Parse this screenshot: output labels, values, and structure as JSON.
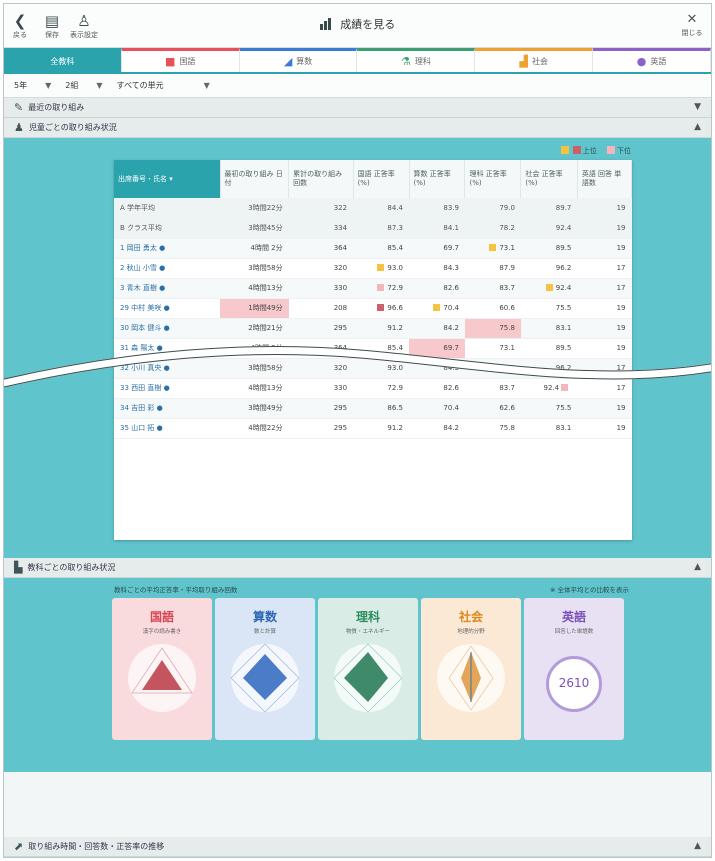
{
  "topbar": {
    "back_label": "戻る",
    "save_label": "保存",
    "print_label": "表示設定",
    "title": "成績を見る",
    "close_label": "閉じる"
  },
  "tabs": [
    {
      "label": "全教科",
      "key": "all"
    },
    {
      "label": "国語",
      "key": "kokugo"
    },
    {
      "label": "算数",
      "key": "sansu"
    },
    {
      "label": "理科",
      "key": "rika"
    },
    {
      "label": "社会",
      "key": "shakai"
    },
    {
      "label": "英語",
      "key": "eigo"
    }
  ],
  "filters": {
    "grade": "5年",
    "class": "2組",
    "scope": "すべての単元"
  },
  "sections": {
    "overall": "最近の取り組み",
    "per_student": "児童ごとの取り組み状況",
    "per_subject": "教科ごとの取り組み状況",
    "footer": "取り組み時間・回答数・正答率の推移"
  },
  "legend": {
    "high": "上位",
    "low": "下位"
  },
  "table": {
    "headers": [
      "出席番号・氏名",
      "最初の取り組み 日付",
      "累計の取り組み 回数",
      "国語 正答率 (%)",
      "算数 正答率 (%)",
      "理科 正答率 (%)",
      "社会 正答率 (%)",
      "英語 回答 単語数"
    ],
    "rows": [
      [
        "A 学年平均",
        "3時間22分",
        "322",
        "84.4",
        "83.9",
        "79.0",
        "89.7",
        "19"
      ],
      [
        "B クラス平均",
        "3時間45分",
        "334",
        "87.3",
        "84.1",
        "78.2",
        "92.4",
        "19"
      ],
      [
        "1 岡田 勇太 ●",
        "4時間 2分",
        "364",
        "85.4",
        "69.7",
        "73.1",
        "89.5",
        "19"
      ],
      [
        "2 秋山 小雪 ●",
        "3時間58分",
        "320",
        "93.0",
        "84.3",
        "87.9",
        "96.2",
        "17"
      ],
      [
        "3 青木 直樹 ●",
        "4時間13分",
        "330",
        "72.9",
        "82.6",
        "83.7",
        "92.4",
        "17"
      ],
      [
        "29 中村 美咲 ●",
        "1時間49分",
        "208",
        "96.6",
        "70.4",
        "60.6",
        "75.5",
        "19"
      ],
      [
        "30 岡本 健斗 ●",
        "2時間21分",
        "295",
        "91.2",
        "84.2",
        "75.8",
        "83.1",
        "19"
      ],
      [
        "31 森 陽太 ●",
        "4時間 2分",
        "364",
        "85.4",
        "69.7",
        "73.1",
        "89.5",
        "19"
      ],
      [
        "32 小川 真央 ●",
        "3時間58分",
        "320",
        "93.0",
        "84.3",
        "87.9",
        "96.2",
        "17"
      ],
      [
        "33 西田 直樹 ●",
        "4時間13分",
        "330",
        "72.9",
        "82.6",
        "83.7",
        "92.4",
        "17"
      ],
      [
        "34 吉田 彩 ●",
        "3時間49分",
        "295",
        "86.5",
        "70.4",
        "62.6",
        "75.5",
        "19"
      ],
      [
        "35 山口 拓 ●",
        "4時間22分",
        "295",
        "91.2",
        "84.2",
        "75.8",
        "83.1",
        "19"
      ]
    ]
  },
  "subjects_panel": {
    "title": "教科ごとの平均正答率・平均取り組み回数",
    "note": "※ 全体平均との比較を表示",
    "cards": [
      {
        "name": "国語",
        "sub": "漢字の読み書き"
      },
      {
        "name": "算数",
        "sub": "数と計算"
      },
      {
        "name": "理科",
        "sub": "物質・エネルギー"
      },
      {
        "name": "社会",
        "sub": "地理的分野"
      },
      {
        "name": "英語",
        "sub": "回答した単語数",
        "count": "2610"
      }
    ]
  },
  "colors": {
    "accent": "#2aa3ad",
    "teal_bg": "#5fc4cc",
    "kokugo": "#e8505b",
    "sansu": "#3a7cd5",
    "rika": "#3aa071",
    "shakai": "#f0a030",
    "eigo": "#8a62c8"
  }
}
